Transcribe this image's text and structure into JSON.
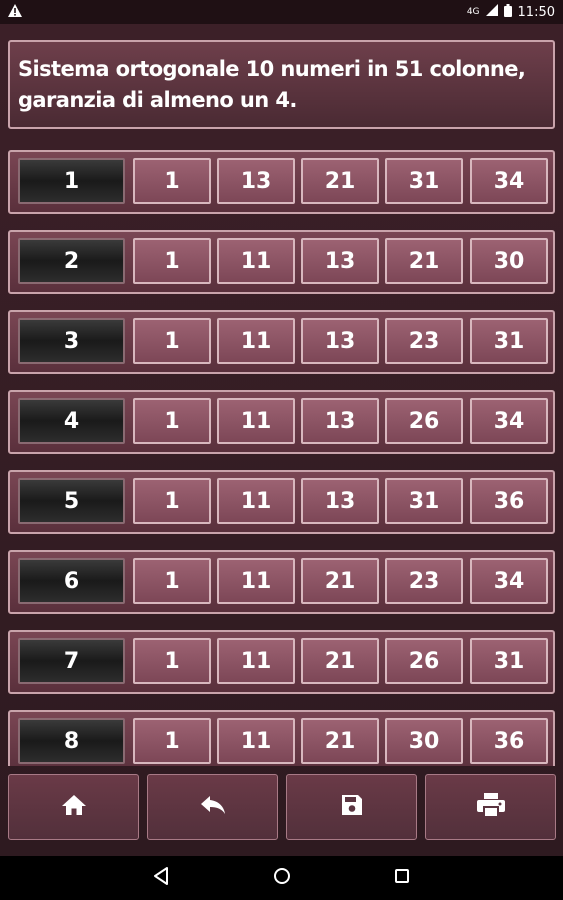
{
  "status_bar": {
    "time": "11:50",
    "network_label": "4G"
  },
  "header": {
    "title": "Sistema ortogonale 10 numeri in 51 colonne, garanzia di almeno un 4."
  },
  "rows": [
    {
      "index": "1",
      "numbers": [
        "1",
        "13",
        "21",
        "31",
        "34"
      ]
    },
    {
      "index": "2",
      "numbers": [
        "1",
        "11",
        "13",
        "21",
        "30"
      ]
    },
    {
      "index": "3",
      "numbers": [
        "1",
        "11",
        "13",
        "23",
        "31"
      ]
    },
    {
      "index": "4",
      "numbers": [
        "1",
        "11",
        "13",
        "26",
        "34"
      ]
    },
    {
      "index": "5",
      "numbers": [
        "1",
        "11",
        "13",
        "31",
        "36"
      ]
    },
    {
      "index": "6",
      "numbers": [
        "1",
        "11",
        "21",
        "23",
        "34"
      ]
    },
    {
      "index": "7",
      "numbers": [
        "1",
        "11",
        "21",
        "26",
        "31"
      ]
    },
    {
      "index": "8",
      "numbers": [
        "1",
        "11",
        "21",
        "30",
        "36"
      ]
    }
  ],
  "toolbar": {
    "buttons": [
      {
        "icon": "home-icon"
      },
      {
        "icon": "back-arrow-icon"
      },
      {
        "icon": "save-icon"
      },
      {
        "icon": "print-icon"
      }
    ]
  },
  "navigation": {
    "buttons": [
      {
        "icon": "back-triangle-icon"
      },
      {
        "icon": "home-circle-icon"
      },
      {
        "icon": "recents-square-icon"
      }
    ]
  }
}
